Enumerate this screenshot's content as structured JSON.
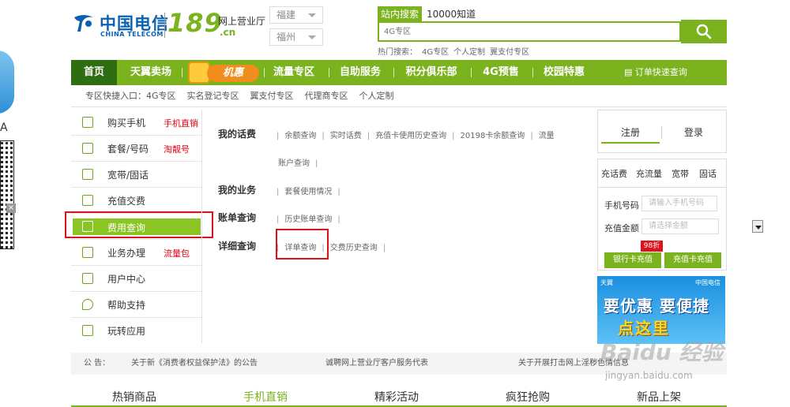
{
  "left_ad": {
    "text": "A"
  },
  "header": {
    "logo_cn": "中国电信",
    "logo_en": "CHINA TELECOM",
    "logo_num": "189",
    "logo_ting": "网上营业厅",
    "logo_dotcn": ".cn",
    "province": "福建",
    "city": "福州"
  },
  "search": {
    "tab": "站内搜索",
    "zhidao": "10000知道",
    "placeholder": "4G专区",
    "hot_label": "热门搜索：",
    "hot": [
      "4G专区",
      "个人定制",
      "翼支付专区"
    ]
  },
  "nav": {
    "items": [
      "首页",
      "天翼卖场",
      "流量专区",
      "自助服务",
      "积分俱乐部",
      "4G预售",
      "校园特惠"
    ],
    "jihui": "机惠",
    "order": "订单快速查询"
  },
  "subnav": {
    "label": "专区快捷入口：",
    "items": [
      "4G专区",
      "实名登记专区",
      "翼支付专区",
      "代理商专区",
      "个人定制"
    ]
  },
  "leftmenu": {
    "items": [
      {
        "label": "购买手机",
        "tag": "手机直销"
      },
      {
        "label": "套餐/号码",
        "tag": "淘靓号"
      },
      {
        "label": "宽带/固话",
        "tag": ""
      },
      {
        "label": "充值交费",
        "tag": ""
      },
      {
        "label": "费用查询",
        "tag": ""
      },
      {
        "label": "业务办理",
        "tag": "流量包"
      },
      {
        "label": "用户中心",
        "tag": ""
      },
      {
        "label": "帮助支持",
        "tag": ""
      },
      {
        "label": "玩转应用",
        "tag": ""
      }
    ]
  },
  "content": {
    "sections": [
      {
        "title": "我的话费",
        "links": [
          "余额查询",
          "实时话费",
          "充值卡使用历史查询",
          "20198卡余额查询",
          "流量",
          "账户查询"
        ]
      },
      {
        "title": "我的业务",
        "links": [
          "套餐使用情况"
        ]
      },
      {
        "title": "账单查询",
        "links": [
          "历史账单查询"
        ]
      },
      {
        "title": "详细查询",
        "links": [
          "详单查询",
          "交费历史查询"
        ]
      }
    ]
  },
  "account": {
    "register": "注册",
    "login": "登录"
  },
  "recharge": {
    "tabs": [
      "充话费",
      "充流量",
      "宽带",
      "固话"
    ],
    "phone_label": "手机号码",
    "phone_placeholder": "请输入手机号码",
    "amount_label": "充值金额",
    "amount_placeholder": "请选择金额",
    "bank_btn": "银行卡充值",
    "card_btn": "充值卡充值",
    "badge": "98折"
  },
  "banner": {
    "logo_left": "天翼",
    "logo_right": "中国电信",
    "line1": "要优惠 要便捷",
    "line2": "点这里"
  },
  "notice": {
    "label": "公 告：",
    "items": [
      "关于新《消费者权益保护法》的公告",
      "诚聘网上营业厅客户服务代表",
      "关于开展打击网上淫秽色情信息"
    ]
  },
  "bottom_tabs": [
    "热销商品",
    "手机直销",
    "精彩活动",
    "疯狂抢购",
    "新品上架"
  ],
  "watermark": {
    "line1": "Baidu 经验",
    "line2": "jingyan.baidu.com"
  },
  "colors": {
    "brand_green": "#7bb31f",
    "dark_green": "#2f6e10",
    "telecom_blue": "#0a61b2",
    "highlight_red": "#e0101b"
  }
}
